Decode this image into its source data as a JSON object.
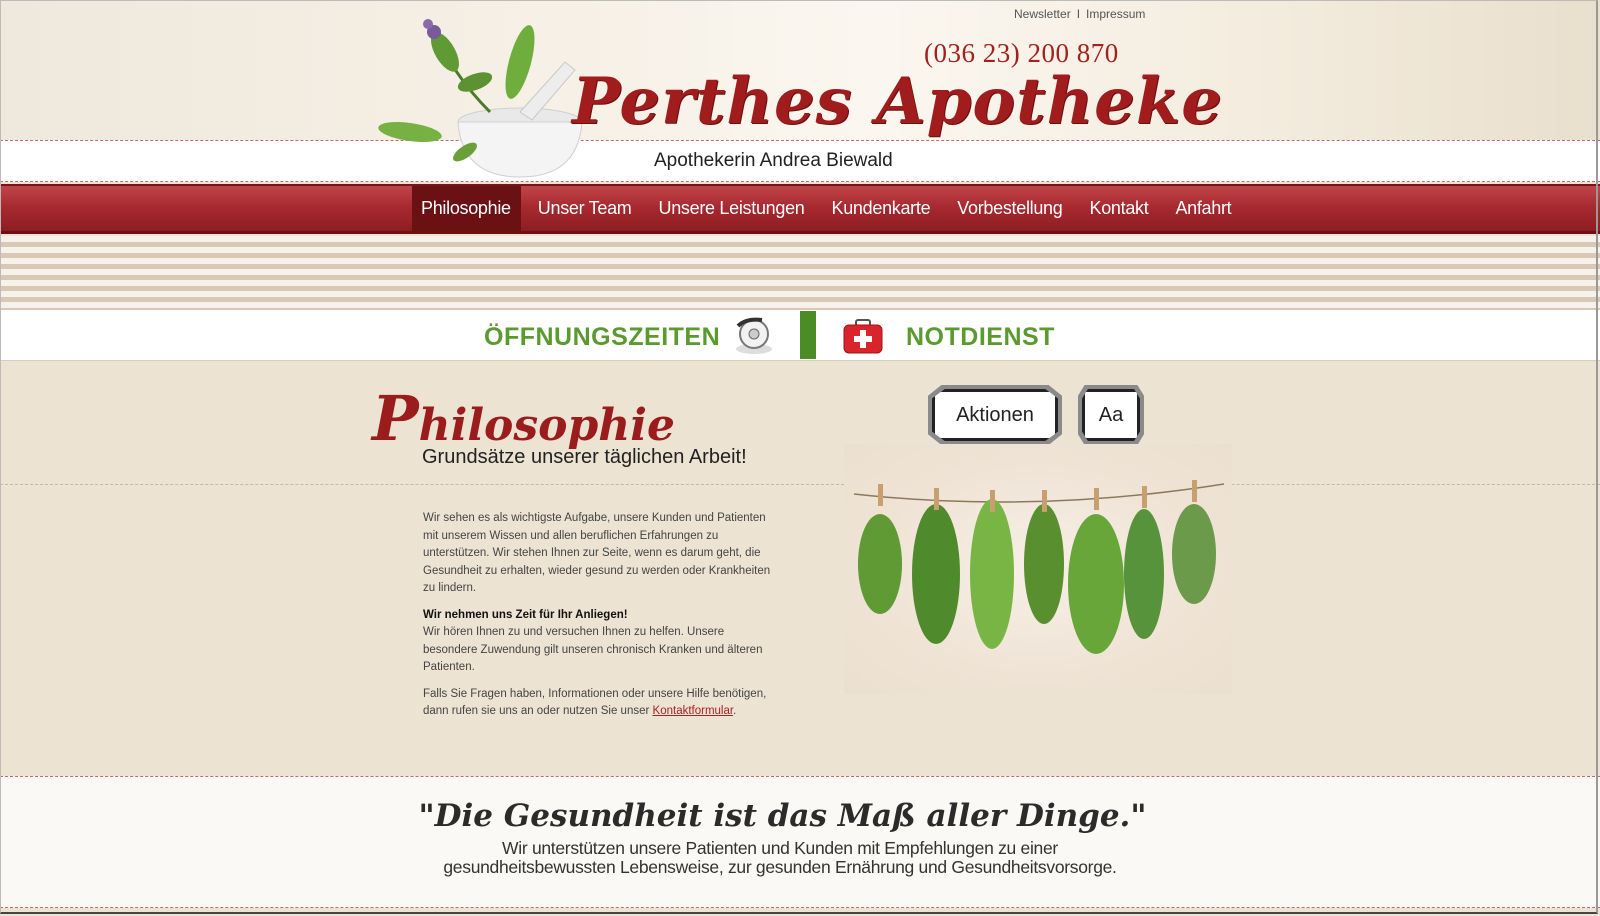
{
  "header": {
    "top_links": [
      "Newsletter",
      "Impressum"
    ],
    "top_links_separator": "I",
    "phone": "(036 23) 200 870",
    "brand": "Perthes Apotheke",
    "sub_brand": "Apothekerin Andrea Biewald"
  },
  "nav": {
    "items": [
      "Philosophie",
      "Unser Team",
      "Unsere Leistungen",
      "Kundenkarte",
      "Vorbestellung",
      "Kontakt",
      "Anfahrt"
    ],
    "active": "Philosophie"
  },
  "info_bar": {
    "hours": "ÖFFNUNGSZEITEN",
    "emergency": "NOTDIENST"
  },
  "main": {
    "title_cap": "P",
    "title_rest": "hilosophie",
    "subtitle": "Grundsätze unserer täglichen Arbeit!",
    "buttons": {
      "aktionen": "Aktionen",
      "font_size": "Aa"
    },
    "paragraph1": "Wir sehen es als wichtigste Aufgabe, unsere Kunden und Patienten mit unserem Wissen und allen beruflichen Erfahrungen zu unterstützen. Wir stehen Ihnen zur Seite, wenn es darum geht, die Gesundheit zu erhalten, wieder gesund zu werden oder Krankheiten zu lindern.",
    "heading2": "Wir nehmen uns Zeit für Ihr Anliegen!",
    "paragraph2": "Wir hören Ihnen zu und versuchen Ihnen zu helfen. Unsere besondere Zuwendung gilt unseren chronisch Kranken und älteren Patienten.",
    "paragraph3_pre": "Falls Sie Fragen haben, Informationen oder unsere Hilfe benötigen, dann rufen sie uns an oder nutzen Sie unser ",
    "paragraph3_link": "Kontaktformular",
    "paragraph3_post": "."
  },
  "footer": {
    "quote": "\"Die Gesundheit ist das Maß aller Dinge.\"",
    "text": "Wir unterstützen unsere Patienten und Kunden mit Empfehlungen zu einer gesundheitsbewussten Lebensweise, zur gesunden Ernährung und Gesundheitsvorsorge."
  },
  "colors": {
    "brand_red": "#a11c1c",
    "nav_red": "#a82a30",
    "nav_active": "#6b1013",
    "green": "#5a9a2e",
    "background": "#ece3d2"
  }
}
